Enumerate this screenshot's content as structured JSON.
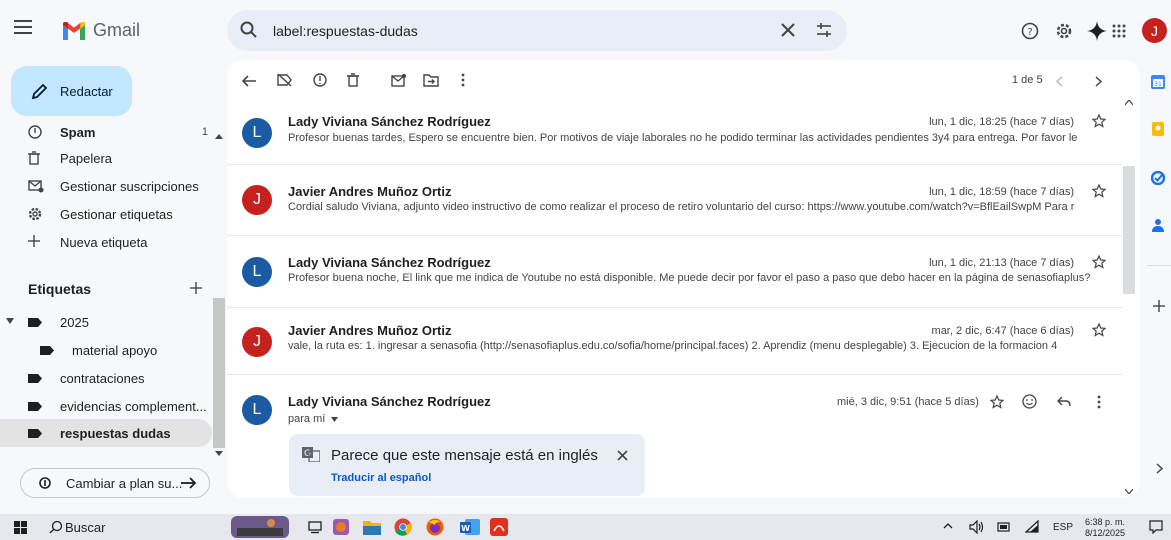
{
  "app": {
    "name": "Gmail",
    "avatar_letter": "J"
  },
  "search": {
    "value": "label:respuestas-dudas"
  },
  "nav": {
    "compose_label": "Redactar",
    "items": [
      {
        "label": "Spam",
        "count": "1",
        "icon": "spam-icon"
      },
      {
        "label": "Papelera",
        "icon": "trash-icon"
      },
      {
        "label": "Gestionar suscripciones",
        "icon": "subscriptions-icon"
      },
      {
        "label": "Gestionar etiquetas",
        "icon": "settings-icon"
      },
      {
        "label": "Nueva etiqueta",
        "icon": "plus-icon"
      }
    ],
    "labels_title": "Etiquetas",
    "labels": [
      {
        "label": "2025"
      },
      {
        "label": "material apoyo"
      },
      {
        "label": "contrataciones"
      },
      {
        "label": "evidencias complement..."
      },
      {
        "label": "respuestas dudas",
        "active": true
      }
    ],
    "upgrade_label": "Cambiar a plan su..."
  },
  "toolbar": {
    "pager": "1 de 5"
  },
  "messages": [
    {
      "avatar": "L",
      "color": "#1a5ba3",
      "sender": "Lady Viviana Sánchez Rodríguez",
      "date": "lun, 1 dic, 18:25 (hace 7 días)",
      "snippet": "Profesor buenas tardes, Espero se encuentre bien. Por motivos de viaje laborales no he podido terminar las actividades pendientes 3y4 para entrega. Por favor le"
    },
    {
      "avatar": "J",
      "color": "#c5221f",
      "sender": "Javier Andres Muñoz Ortiz",
      "date": "lun, 1 dic, 18:59 (hace 7 días)",
      "snippet": "Cordial saludo Viviana, adjunto video instructivo de como realizar el proceso de retiro voluntario del curso: https://www.youtube.com/watch?v=BflEailSwpM Para r"
    },
    {
      "avatar": "L",
      "color": "#1a5ba3",
      "sender": "Lady Viviana Sánchez Rodríguez",
      "date": "lun, 1 dic, 21:13 (hace 7 días)",
      "snippet": "Profesor buena noche, El link que me indica de Youtube no está disponible. Me puede decir por favor el paso a paso que debo hacer en la página de senasofiaplus?"
    },
    {
      "avatar": "J",
      "color": "#c5221f",
      "sender": "Javier Andres Muñoz Ortiz",
      "date": "mar, 2 dic, 6:47 (hace 6 días)",
      "snippet": "vale, la ruta es: 1. ingresar a senasofia (http://senasofiaplus.edu.co/sofia/home/principal.faces) 2. Aprendiz (menu desplegable) 3. Ejecucion de la formacion 4"
    }
  ],
  "open_message": {
    "avatar": "L",
    "color": "#1a5ba3",
    "sender": "Lady Viviana Sánchez Rodríguez",
    "date": "mié, 3 dic, 9:51 (hace 5 días)",
    "recipient": "para mí",
    "translate_text": "Parece que este mensaje está en inglés",
    "translate_link": "Traducir al español"
  },
  "taskbar": {
    "search_label": "Buscar",
    "lang": "ESP",
    "time": "6:38 p. m.",
    "date": "8/12/2025"
  }
}
